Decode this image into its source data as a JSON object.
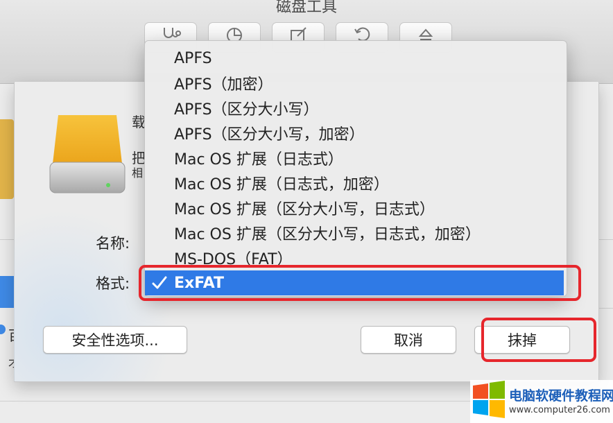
{
  "window": {
    "title": "磁盘工具"
  },
  "sheet": {
    "name_label": "名称:",
    "format_label": "格式:",
    "peek_chars": [
      "载",
      "把",
      "相"
    ],
    "left_peek_chars": [
      "百",
      "才"
    ],
    "security_button": "安全性选项...",
    "cancel_button": "取消",
    "erase_button": "抹掉"
  },
  "format_menu": {
    "items": [
      "APFS",
      "APFS（加密）",
      "APFS（区分大小写）",
      "APFS（区分大小写，加密）",
      "Mac OS 扩展（日志式）",
      "Mac OS 扩展（日志式，加密）",
      "Mac OS 扩展（区分大小写，日志式）",
      "Mac OS 扩展（区分大小写，日志式，加密）",
      "MS-DOS（FAT）",
      "ExFAT"
    ],
    "selected": "ExFAT"
  },
  "watermark": {
    "name": "电脑软硬件教程网",
    "url": "www.computer26.com"
  },
  "colors": {
    "selection": "#2f7ae6",
    "highlight_box": "#e6262c",
    "drive": "#f3b42a"
  }
}
